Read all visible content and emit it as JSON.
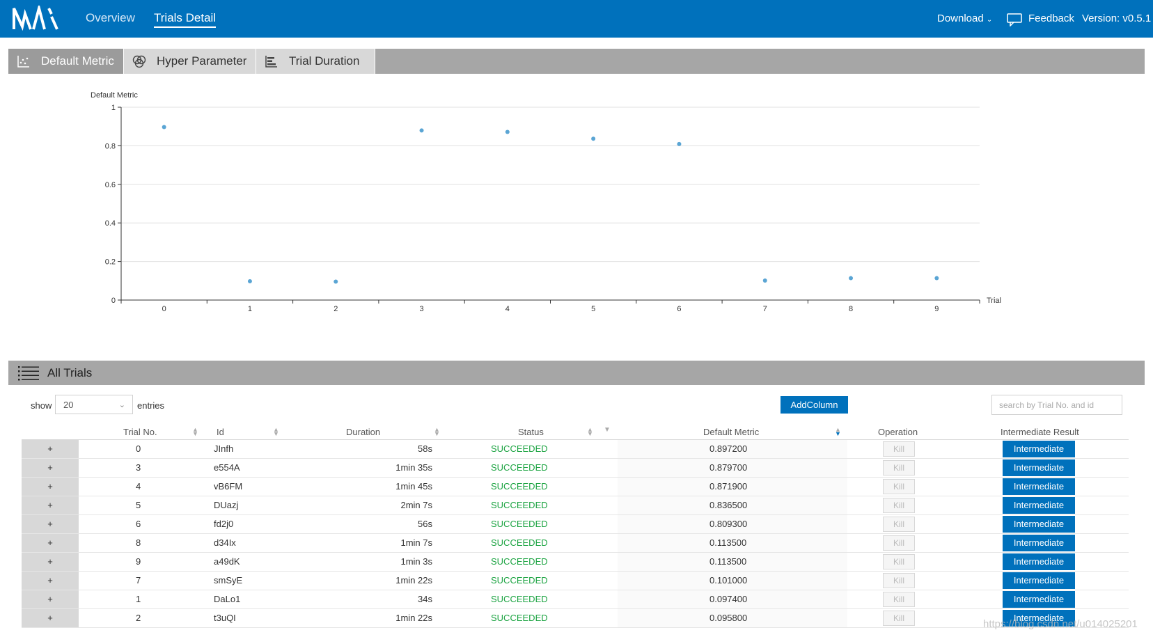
{
  "nav": {
    "links": [
      "Overview",
      "Trials Detail"
    ],
    "download": "Download",
    "feedback": "Feedback",
    "version": "Version: v0.5.1"
  },
  "tabs": [
    {
      "label": "Default Metric",
      "icon": "scatter-chart-icon"
    },
    {
      "label": "Hyper Parameter",
      "icon": "parallel-coordinates-icon"
    },
    {
      "label": "Trial Duration",
      "icon": "bar-chart-icon"
    }
  ],
  "chart_data": {
    "type": "scatter",
    "ylabel": "Default Metric",
    "xlabel": "Trial",
    "ylim": [
      0,
      1
    ],
    "yticks": [
      0,
      0.2,
      0.4,
      0.6,
      0.8,
      1
    ],
    "xticks": [
      0,
      1,
      2,
      3,
      4,
      5,
      6,
      7,
      8,
      9
    ],
    "grid": true,
    "color": "#5aa5d4",
    "x": [
      0,
      1,
      2,
      3,
      4,
      5,
      6,
      7,
      8,
      9
    ],
    "y": [
      0.8972,
      0.0974,
      0.0958,
      0.8797,
      0.8719,
      0.8365,
      0.8093,
      0.101,
      0.1135,
      0.1135
    ]
  },
  "trials_section": {
    "title": "All Trials",
    "show_label": "show",
    "entries_value": "20",
    "entries_label": "entries",
    "add_column": "AddColumn",
    "search_placeholder": "search by Trial No. and id"
  },
  "table": {
    "headers": {
      "trial_no": "Trial No.",
      "id": "Id",
      "duration": "Duration",
      "status": "Status",
      "metric": "Default Metric",
      "operation": "Operation",
      "intermediate": "Intermediate Result"
    },
    "expand_label": "+",
    "kill_label": "Kill",
    "intermediate_label": "Intermediate",
    "rows": [
      {
        "no": "0",
        "id": "JInfh",
        "duration": "58s",
        "status": "SUCCEEDED",
        "metric": "0.897200"
      },
      {
        "no": "3",
        "id": "e554A",
        "duration": "1min 35s",
        "status": "SUCCEEDED",
        "metric": "0.879700"
      },
      {
        "no": "4",
        "id": "vB6FM",
        "duration": "1min 45s",
        "status": "SUCCEEDED",
        "metric": "0.871900"
      },
      {
        "no": "5",
        "id": "DUazj",
        "duration": "2min 7s",
        "status": "SUCCEEDED",
        "metric": "0.836500"
      },
      {
        "no": "6",
        "id": "fd2j0",
        "duration": "56s",
        "status": "SUCCEEDED",
        "metric": "0.809300"
      },
      {
        "no": "8",
        "id": "d34Ix",
        "duration": "1min 7s",
        "status": "SUCCEEDED",
        "metric": "0.113500"
      },
      {
        "no": "9",
        "id": "a49dK",
        "duration": "1min 3s",
        "status": "SUCCEEDED",
        "metric": "0.113500"
      },
      {
        "no": "7",
        "id": "smSyE",
        "duration": "1min 22s",
        "status": "SUCCEEDED",
        "metric": "0.101000"
      },
      {
        "no": "1",
        "id": "DaLo1",
        "duration": "34s",
        "status": "SUCCEEDED",
        "metric": "0.097400"
      },
      {
        "no": "2",
        "id": "t3uQI",
        "duration": "1min 22s",
        "status": "SUCCEEDED",
        "metric": "0.095800"
      }
    ]
  },
  "watermark": "https://blog.csdn.net/u014025201"
}
